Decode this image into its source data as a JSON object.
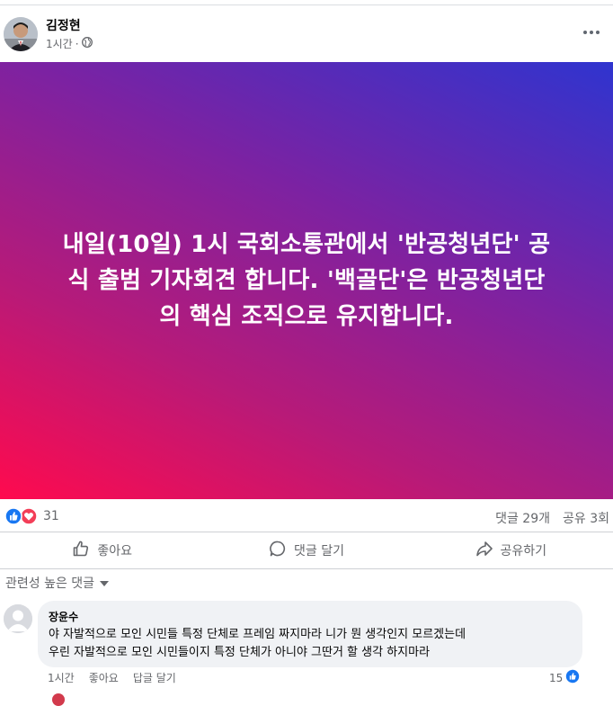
{
  "post": {
    "author": "김정현",
    "time": "1시간",
    "privacy_icon": "globe-icon",
    "banner_lines": [
      "내일(10일) 1시 국회소통관에서 '반공청년단' 공",
      "식 출범 기자회견 합니다. '백골단'은 반공청년단",
      "의 핵심 조직으로 유지합니다."
    ],
    "reaction_count": "31",
    "comments_count": "댓글 29개",
    "shares_count": "공유 3회"
  },
  "actions": {
    "like": "좋아요",
    "comment": "댓글 달기",
    "share": "공유하기"
  },
  "comments_section": {
    "sort_label": "관련성 높은 댓글",
    "comments": [
      {
        "author": "장윤수",
        "lines": [
          "야 자발적으로 모인 시민들 특정 단체로 프레임 짜지마라 니가 뭔 생각인지 모르겠는데",
          "우린 자발적으로 모인 시민들이지 특정 단체가 아니야 그딴거 할 생각 하지마라"
        ],
        "time": "1시간",
        "like_label": "좋아요",
        "reply_label": "답글 달기",
        "like_count": "15"
      }
    ]
  },
  "colors": {
    "facebook_blue": "#1877f2",
    "love_red": "#f33e58",
    "gradient_start": "#ff0a4e",
    "gradient_end": "#2f34cf"
  }
}
